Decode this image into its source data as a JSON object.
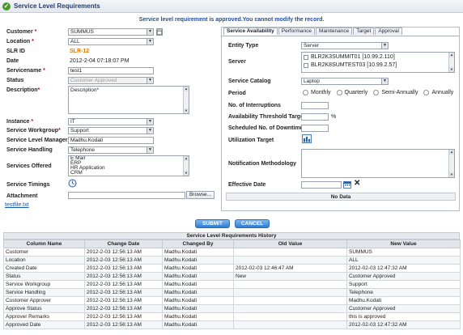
{
  "window": {
    "title": "Service Level Requirements"
  },
  "message": "Service level requirement is approved.You cannot modify the record.",
  "form": {
    "customer": {
      "label": "Customer",
      "value": "SUMMUS"
    },
    "location": {
      "label": "Location",
      "value": "ALL"
    },
    "slr_id": {
      "label": "SLR ID",
      "value": "SLR-12"
    },
    "date": {
      "label": "Date",
      "value": "2012-2-04 07:18:07 PM"
    },
    "servicename": {
      "label": "Servicename",
      "value": "test1"
    },
    "status": {
      "label": "Status",
      "value": "Customer Approved"
    },
    "description": {
      "label": "Description",
      "value": "Description*"
    },
    "instance": {
      "label": "Instance",
      "value": "IT"
    },
    "service_workgroup": {
      "label": "Service Workgroup",
      "value": "Support"
    },
    "service_level_manager": {
      "label": "Service Level Manager",
      "value": "Madhu.Kodati"
    },
    "service_handling": {
      "label": "Service Handling",
      "value": "Telephone"
    },
    "services_offered": {
      "label": "Services Offered",
      "options": [
        "E Mail",
        "ERP",
        "HR Application",
        "CRM"
      ]
    },
    "service_timings": {
      "label": "Service Timings"
    },
    "attachment": {
      "label": "Attachment",
      "browse": "Browse..."
    },
    "file_link": "testfile.txt"
  },
  "tabs": [
    "Service Availability",
    "Performance",
    "Maintenance",
    "Target",
    "Approval"
  ],
  "availability": {
    "entity_type": {
      "label": "Entity Type",
      "value": "Server"
    },
    "server": {
      "label": "Server",
      "items": [
        "BLR2K3SUMMIT01 [10.99.2.110]",
        "BLR2K8SUMTEST03 [10.99.2.57]"
      ]
    },
    "service_catalog": {
      "label": "Service Catalog",
      "value": "Laptop"
    },
    "period": {
      "label": "Period",
      "options": [
        "Monthly",
        "Quarterly",
        "Semi-Annually",
        "Annually"
      ]
    },
    "interruptions": {
      "label": "No. of Interruptions"
    },
    "threshold": {
      "label": "Availability Threshold Target",
      "unit": "%"
    },
    "downtime": {
      "label": "Scheduled No. of Downtime"
    },
    "utilization": {
      "label": "Utilization Target"
    },
    "notification": {
      "label": "Notification Methodology"
    },
    "effective_date": {
      "label": "Effective Date"
    },
    "no_data": "No Data"
  },
  "buttons": {
    "submit": "SUBMIT",
    "cancel": "CANCEL"
  },
  "history": {
    "title": "Service Level Requirements History",
    "columns": [
      "Column Name",
      "Change Date",
      "Changed By",
      "Old Value",
      "New Value"
    ],
    "rows": [
      [
        "Customer",
        "2012-2-03 12:56:13 AM",
        "Madhu.Kodati",
        "",
        "SUMMUS"
      ],
      [
        "Location",
        "2012-2-03 12:56:13 AM",
        "Madhu.Kodati",
        "",
        "ALL"
      ],
      [
        "Created Date",
        "2012-2-03 12:56:13 AM",
        "Madhu.Kodati",
        "2012-02-03 12:46:47 AM",
        "2012-02-03 12:47:32 AM"
      ],
      [
        "Status",
        "2012-2-03 12:56:13 AM",
        "Madhu.Kodati",
        "New",
        "Customer Approved"
      ],
      [
        "Service Workgroup",
        "2012-2-03 12:56:13 AM",
        "Madhu.Kodati",
        "",
        "Support"
      ],
      [
        "Service Handling",
        "2012-2-03 12:56:13 AM",
        "Madhu.Kodati",
        "",
        "Telephone"
      ],
      [
        "Customer Approver",
        "2012-2-03 12:56:13 AM",
        "Madhu.Kodati",
        "",
        "Madhu.Kodati"
      ],
      [
        "Approve Status",
        "2012-2-03 12:56:13 AM",
        "Madhu.Kodati",
        "",
        "Customer Approved"
      ],
      [
        "Approver Remarks",
        "2012-2-03 12:56:13 AM",
        "Madhu.Kodati",
        "",
        "this is approved"
      ],
      [
        "Approved Date",
        "2012-2-03 12:56:13 AM",
        "Madhu.Kodati",
        "",
        "2012-02-03 12:47:32 AM"
      ]
    ]
  },
  "colors": {
    "accent": "#1f4e99",
    "slr_id": "#e07a00",
    "required": "#cc0000"
  },
  "icons": [
    "logo-icon",
    "calendar-icon",
    "clock-icon",
    "utilization-icon",
    "clear-icon"
  ]
}
